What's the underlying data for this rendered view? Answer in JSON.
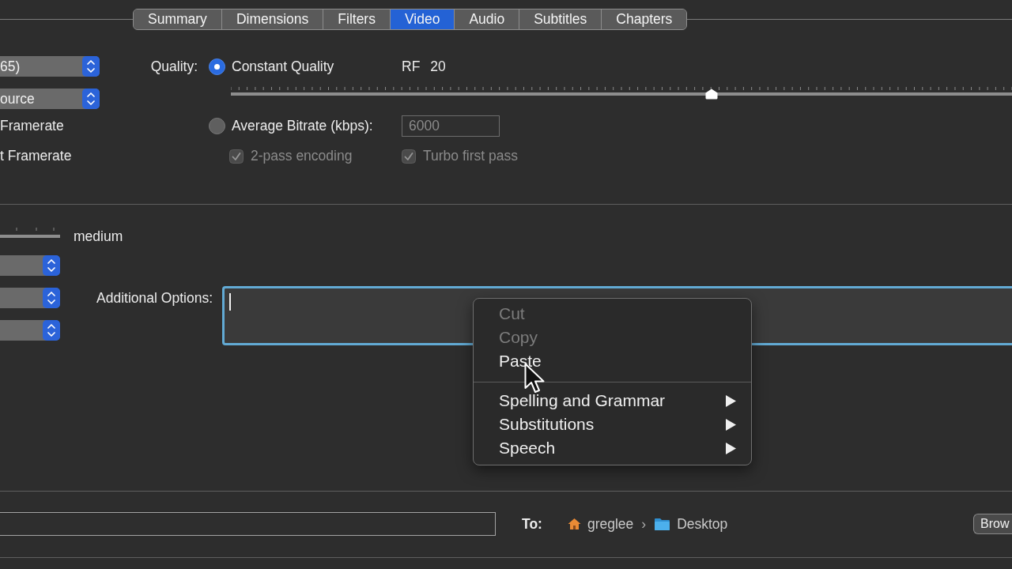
{
  "tabs": [
    {
      "label": "Summary",
      "selected": false
    },
    {
      "label": "Dimensions",
      "selected": false
    },
    {
      "label": "Filters",
      "selected": false
    },
    {
      "label": "Video",
      "selected": true
    },
    {
      "label": "Audio",
      "selected": false
    },
    {
      "label": "Subtitles",
      "selected": false
    },
    {
      "label": "Chapters",
      "selected": false
    }
  ],
  "video": {
    "encoder_popup": "65)",
    "framerate_popup": "ource",
    "framerate_modes": [
      "Framerate",
      "t Framerate"
    ],
    "quality": {
      "label": "Quality:",
      "modes": [
        {
          "label": "Constant Quality",
          "selected": true
        },
        {
          "label": "Average Bitrate (kbps):",
          "selected": false
        }
      ],
      "rf_label": "RF",
      "rf_value": "20",
      "slider": {
        "level": 0.615
      },
      "bitrate_field": {
        "value": "6000",
        "disabled": true
      },
      "checkboxes": [
        {
          "label": "2-pass encoding",
          "checked": true,
          "disabled": true
        },
        {
          "label": "Turbo first pass",
          "checked": true,
          "disabled": true
        }
      ]
    }
  },
  "encoder_options": {
    "preset_value": "medium",
    "additional_options": {
      "label": "Additional Options:",
      "focused": true
    }
  },
  "context_menu": {
    "items": [
      {
        "kind": "action",
        "label": "Cut",
        "disabled": true
      },
      {
        "kind": "action",
        "label": "Copy",
        "disabled": true
      },
      {
        "kind": "action",
        "label": "Paste",
        "disabled": false
      },
      {
        "kind": "separator"
      },
      {
        "kind": "submenu",
        "label": "Spelling and Grammar",
        "disabled": false
      },
      {
        "kind": "submenu",
        "label": "Substitutions",
        "disabled": false
      },
      {
        "kind": "submenu",
        "label": "Speech",
        "disabled": false
      }
    ]
  },
  "destination": {
    "label": "To:",
    "path": [
      {
        "kind": "home",
        "label": "greglee"
      },
      {
        "kind": "folder",
        "label": "Desktop"
      }
    ],
    "path_separator": "›",
    "browse_button": "Brow"
  }
}
